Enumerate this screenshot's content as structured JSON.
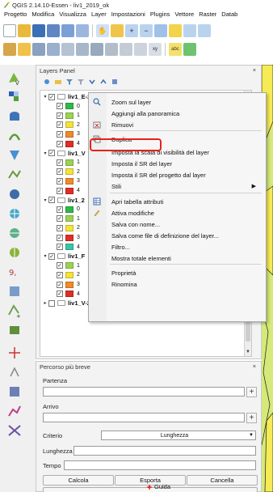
{
  "window": {
    "title": "QGIS 2.14.10-Essen - liv1_2019_ok"
  },
  "menubar": {
    "items": [
      "Progetto",
      "Modifica",
      "Visualizza",
      "Layer",
      "Impostazioni",
      "Plugins",
      "Vettore",
      "Raster",
      "Datab"
    ]
  },
  "colors": {
    "accent_red": "#e8201d",
    "map_green": "#d5e87a",
    "map_yellow": "#f6ea55",
    "map_line": "#1a1a1a"
  },
  "layers_panel": {
    "title": "Layers Panel",
    "controls": "×",
    "groups": [
      {
        "name": "liv1_E-2019",
        "checked": true,
        "expanded": true,
        "classes": [
          {
            "label": "0",
            "color": "#2fb84a"
          },
          {
            "label": "1",
            "color": "#9bd255"
          },
          {
            "label": "2",
            "color": "#f4e33a"
          },
          {
            "label": "3",
            "color": "#f08a2a"
          },
          {
            "label": "4",
            "color": "#e02d27"
          }
        ]
      },
      {
        "name": "liv1_V",
        "checked": true,
        "expanded": true,
        "classes": [
          {
            "label": "1",
            "color": "#9bd255"
          },
          {
            "label": "2",
            "color": "#f4e33a"
          },
          {
            "label": "3",
            "color": "#f08a2a"
          },
          {
            "label": "4",
            "color": "#e02d27"
          }
        ]
      },
      {
        "name": "liv1_2",
        "checked": true,
        "expanded": true,
        "classes": [
          {
            "label": "0",
            "color": "#2fb84a"
          },
          {
            "label": "1",
            "color": "#9bd255"
          },
          {
            "label": "2",
            "color": "#f4e33a"
          },
          {
            "label": "3",
            "color": "#e02d27"
          },
          {
            "label": "4",
            "color": "#37c6a8"
          }
        ]
      },
      {
        "name": "liv1_F",
        "checked": true,
        "expanded": true,
        "classes": [
          {
            "label": "1",
            "color": "#9bd255"
          },
          {
            "label": "2",
            "color": "#f4e33a"
          },
          {
            "label": "3",
            "color": "#f08a2a"
          },
          {
            "label": "4",
            "color": "#e02d27"
          }
        ]
      },
      {
        "name": "liv1_V-2019",
        "checked": false,
        "expanded": false,
        "classes": []
      }
    ]
  },
  "context_menu": {
    "items": [
      {
        "label": "Zoom sul layer",
        "icon": "zoom-layer-icon"
      },
      {
        "label": "Aggiungi alla panoramica",
        "icon": ""
      },
      {
        "label": "Rimuovi",
        "icon": "remove-icon"
      },
      {
        "label": "Duplica",
        "icon": "duplicate-icon",
        "highlighted": true
      },
      {
        "label": "Imposta la scala di visibilità del layer",
        "icon": ""
      },
      {
        "label": "Imposta il SR del layer",
        "icon": ""
      },
      {
        "label": "Imposta il SR del progetto dal layer",
        "icon": ""
      },
      {
        "label": "Stili",
        "icon": "",
        "submenu": true
      },
      {
        "label": "Apri tabella attributi",
        "icon": "table-icon"
      },
      {
        "label": "Attiva modifiche",
        "icon": "pencil-icon"
      },
      {
        "label": "Salva con nome...",
        "icon": ""
      },
      {
        "label": "Salva come file di definizione del layer...",
        "icon": ""
      },
      {
        "label": "Filtro...",
        "icon": ""
      },
      {
        "label": "Mostra totale elementi",
        "icon": ""
      },
      {
        "label": "Proprietà",
        "icon": ""
      },
      {
        "label": "Rinomina",
        "icon": ""
      }
    ]
  },
  "route_panel": {
    "title": "Percorso più breve",
    "controls": "×",
    "start_label": "Partenza",
    "start_value": "",
    "end_label": "Arrivo",
    "end_value": "",
    "criterion_label": "Criterio",
    "criterion_value": "Lunghezza",
    "length_label": "Lunghezza",
    "length_value": "",
    "time_label": "Tempo",
    "time_value": "",
    "calc_button": "Calcola",
    "export_button": "Esporta",
    "clear_button": "Cancella",
    "help_button": "Guida"
  }
}
